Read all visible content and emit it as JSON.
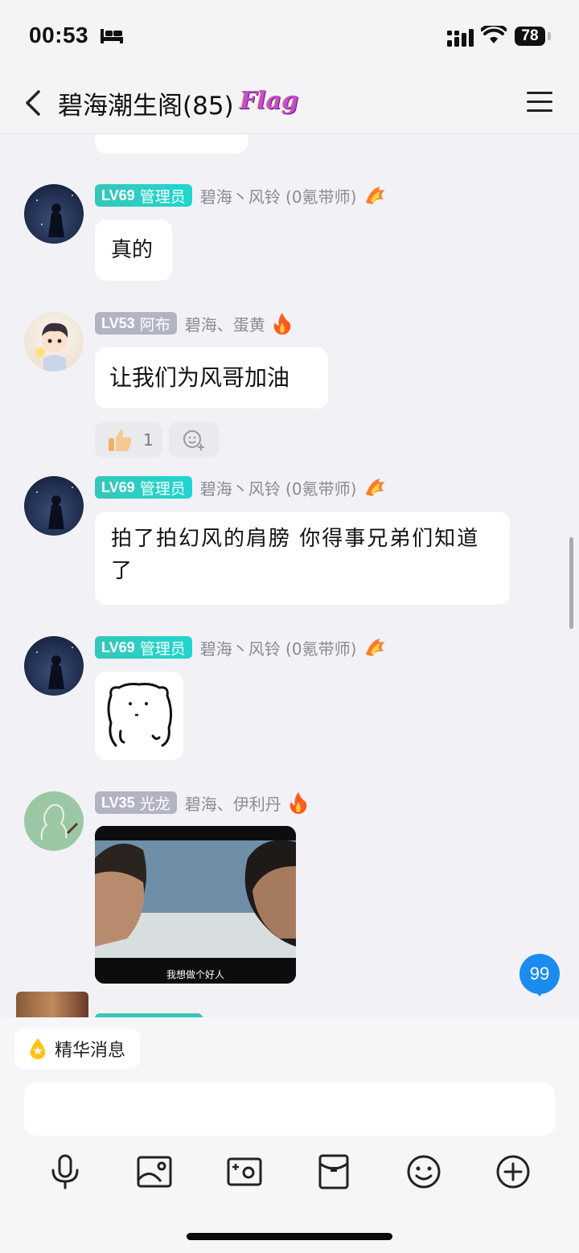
{
  "status_bar": {
    "time": "00:53",
    "battery": "78"
  },
  "header": {
    "title": "碧海潮生阁(85)",
    "badge": "Flag"
  },
  "messages": [
    {
      "level": "LV69",
      "title": "管理员",
      "name": "碧海丶风铃 (0氪带师)",
      "text": "真的"
    },
    {
      "level": "LV53",
      "title": "阿布",
      "name": "碧海、蛋黄",
      "text": "让我们为风哥加油",
      "like_count": "1"
    },
    {
      "level": "LV69",
      "title": "管理员",
      "name": "碧海丶风铃 (0氪带师)",
      "text": "拍了拍幻风的肩膀 你得事兄弟们知道了"
    },
    {
      "level": "LV69",
      "title": "管理员",
      "name": "碧海丶风铃 (0氪带师)"
    },
    {
      "level": "LV35",
      "title": "光龙",
      "name": "碧海、伊利丹",
      "image_caption": "我想做个好人"
    }
  ],
  "unread_count": "99",
  "input": {
    "essence_label": "精华消息"
  },
  "toolbar": [
    "microphone-icon",
    "image-icon",
    "camera-icon",
    "red-packet-icon",
    "emoji-icon",
    "plus-icon"
  ],
  "colors": {
    "admin_badge": "#1fd6d0",
    "level_badge": "#b2b4c4",
    "unread": "#1a8cf0",
    "background": "#f2f2f6"
  }
}
